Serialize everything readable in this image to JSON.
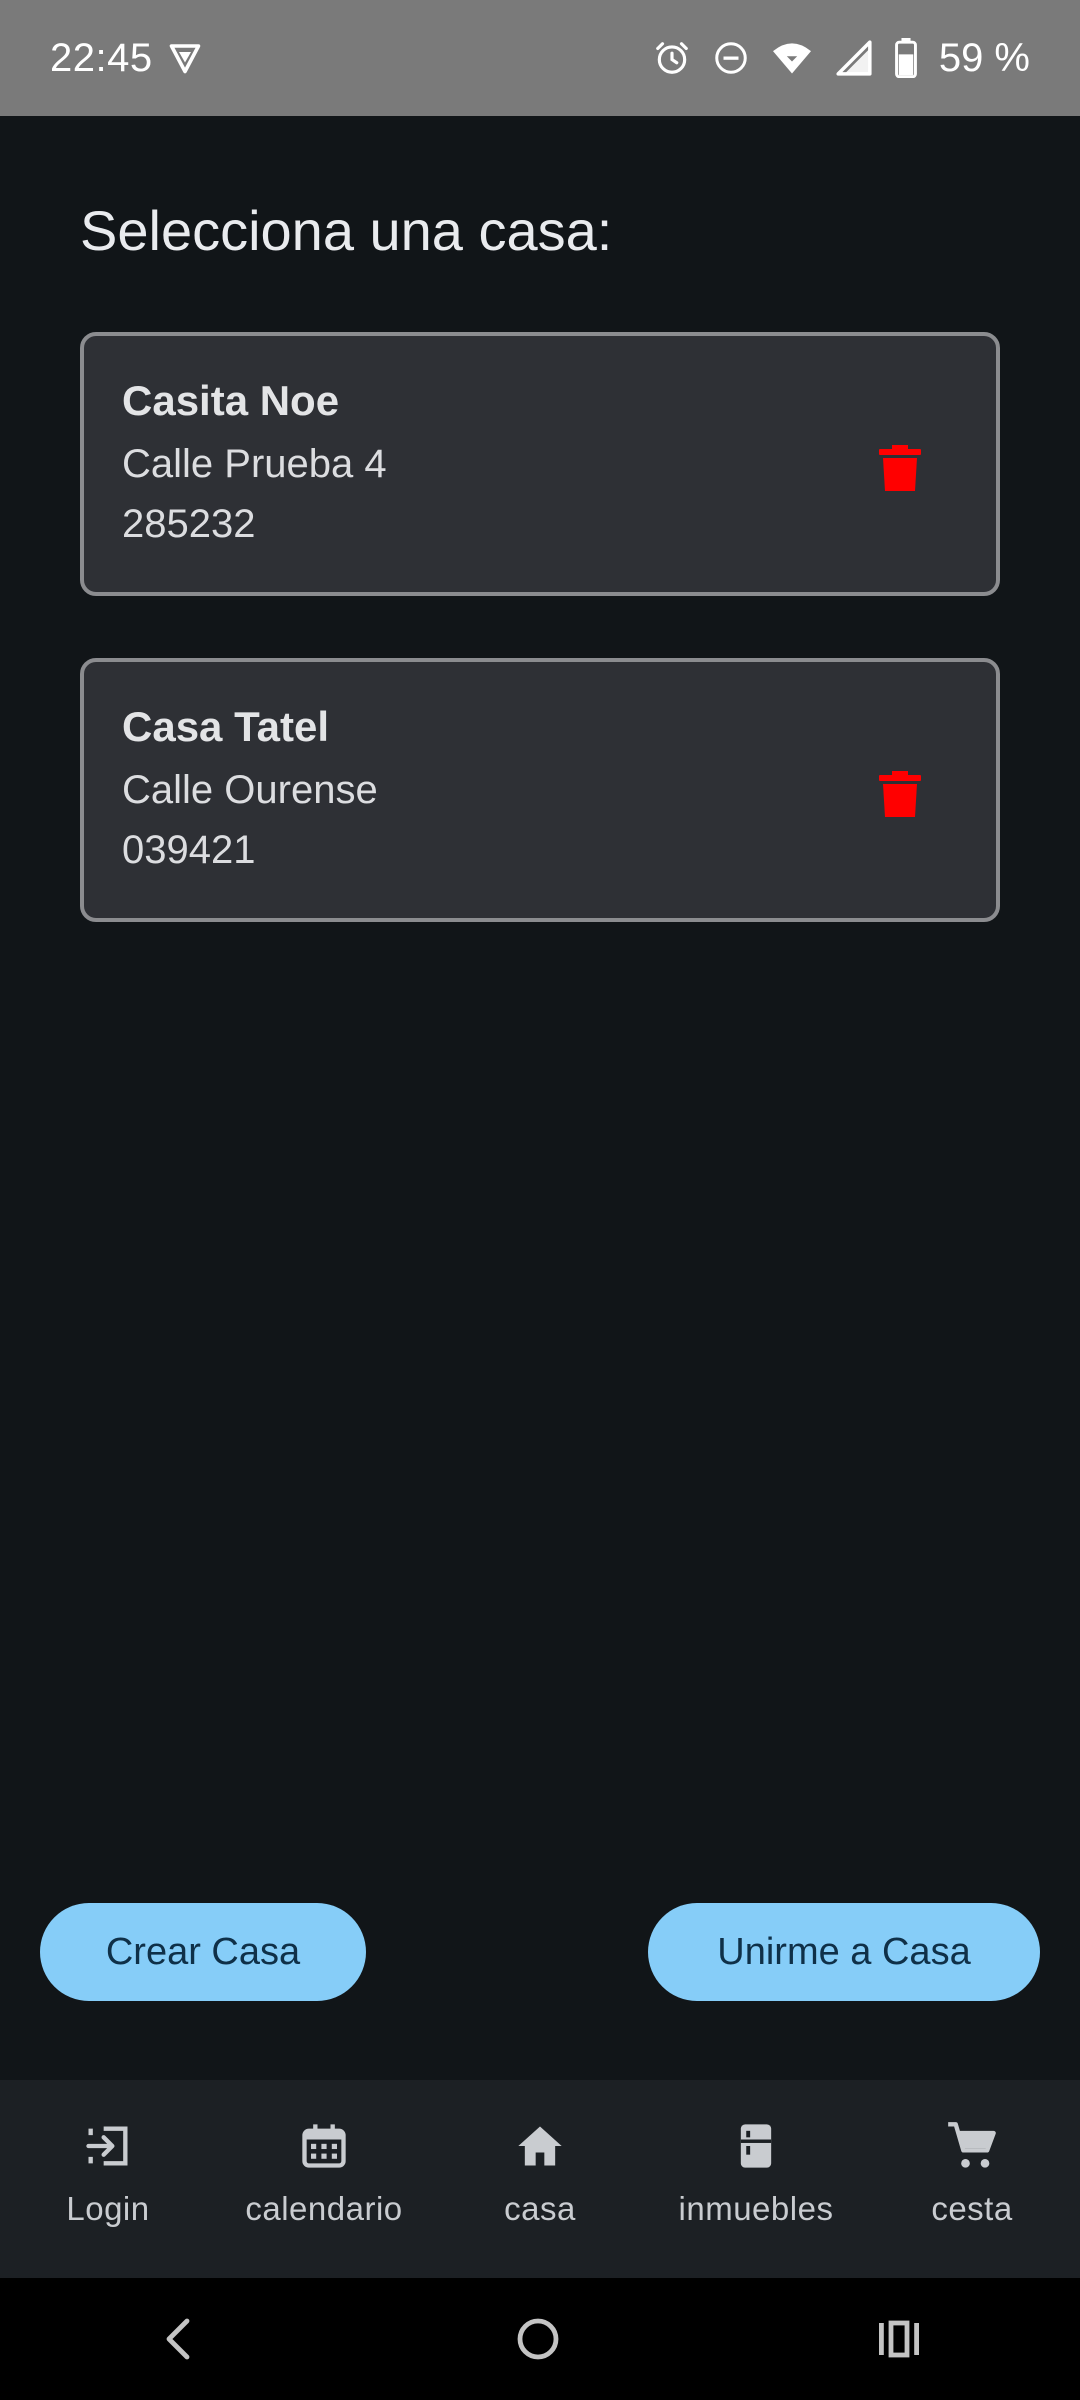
{
  "status_bar": {
    "time": "22:45",
    "battery": "59 %",
    "icons": [
      "vpn-shield-icon",
      "alarm-icon",
      "do-not-disturb-icon",
      "wifi-icon",
      "signal-icon",
      "battery-icon"
    ]
  },
  "page": {
    "title": "Selecciona una casa:"
  },
  "houses": [
    {
      "name": "Casita Noe",
      "address": "Calle Prueba 4",
      "code": "285232",
      "delete_icon": "trash-icon"
    },
    {
      "name": "Casa Tatel",
      "address": "Calle Ourense",
      "code": "039421",
      "delete_icon": "trash-icon"
    }
  ],
  "actions": {
    "create_label": "Crear Casa",
    "join_label": "Unirme a Casa"
  },
  "bottom_nav": {
    "items": [
      {
        "label": "Login",
        "icon": "login-icon"
      },
      {
        "label": "calendario",
        "icon": "calendar-icon"
      },
      {
        "label": "casa",
        "icon": "home-icon"
      },
      {
        "label": "inmuebles",
        "icon": "fridge-icon"
      },
      {
        "label": "cesta",
        "icon": "cart-icon"
      }
    ]
  },
  "system_nav": {
    "icons": [
      "back-icon",
      "home-circle-icon",
      "recents-icon"
    ]
  },
  "colors": {
    "background": "#111518",
    "card": "#2e3035",
    "accent_button": "#86cdf8",
    "delete": "#ff0000",
    "status_bar": "#7a7a7a"
  }
}
